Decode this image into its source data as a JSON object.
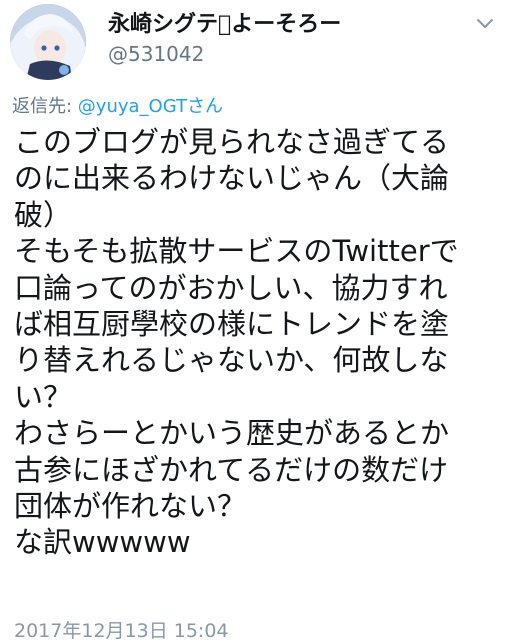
{
  "tweet": {
    "display_name": "永崎シグテ\u0000よーそろー",
    "handle": "@531042",
    "reply_prefix": "返信先: ",
    "reply_mention": "@yuya_OGTさん",
    "lines": [
      "このブログが見られなさ過ぎてる",
      "のに出来るわけないじゃん（大論",
      "破）",
      "そもそも拡散サービスのTwitterで",
      "口論ってのがおかしい、協力すれ",
      "ば相互厨學校の様にトレンドを塗",
      "り替えれるじゃないか、何故しな",
      "い？",
      "わさらーとかいう歴史があるとか",
      "古参にほざかれてるだけの数だけ",
      "団体が作れない？",
      "な訳wwwww"
    ],
    "timestamp": "2017年12月13日 15:04",
    "more_icon": "chevron-down-icon",
    "avatar_icon": "anime-avatar"
  }
}
